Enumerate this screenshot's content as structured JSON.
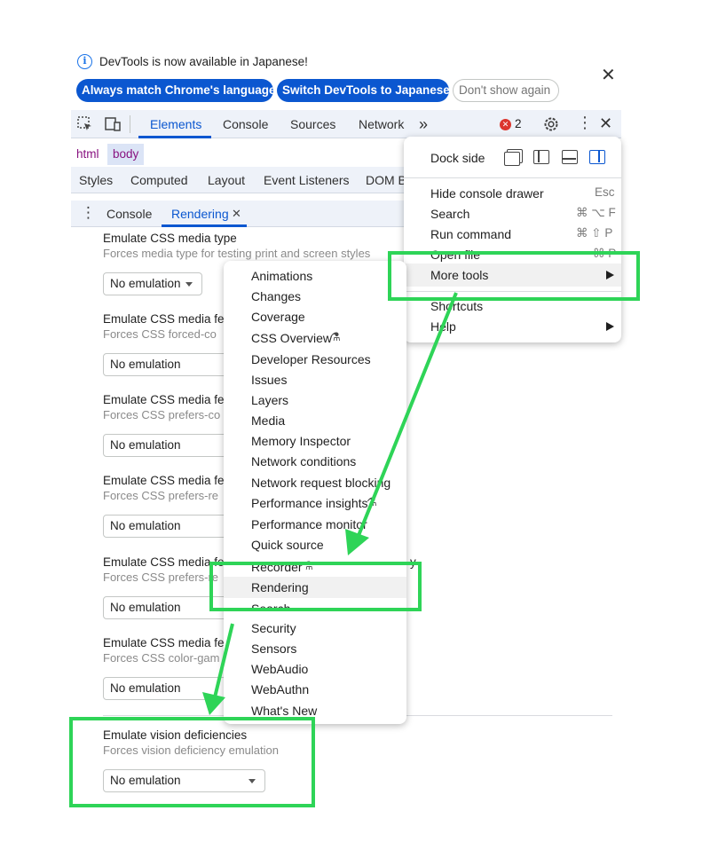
{
  "infobar": {
    "message": "DevTools is now available in Japanese!",
    "buttons": [
      "Always match Chrome's language",
      "Switch DevTools to Japanese",
      "Don't show again"
    ]
  },
  "toolbar": {
    "tabs": [
      "Elements",
      "Console",
      "Sources",
      "Network"
    ],
    "more_tabs": "»",
    "error_count": "2"
  },
  "breadcrumb": [
    "html",
    "body"
  ],
  "subtabs": [
    "Styles",
    "Computed",
    "Layout",
    "Event Listeners",
    "DOM B"
  ],
  "drawer": {
    "tabs": [
      "Console",
      "Rendering"
    ]
  },
  "rendering": {
    "sections": [
      {
        "title": "Emulate CSS media type",
        "desc": "Forces media type for testing print and screen styles",
        "value": "No emulation"
      },
      {
        "title": "Emulate CSS media fe",
        "desc": "Forces CSS forced-co",
        "value": "No emulation"
      },
      {
        "title": "Emulate CSS media fe",
        "desc": "Forces CSS prefers-co",
        "value": "No emulation"
      },
      {
        "title": "Emulate CSS media fe",
        "desc": "Forces CSS prefers-re",
        "value": "No emulation"
      },
      {
        "title": "Emulate CSS media fe",
        "title_tail": "y",
        "desc": "Forces CSS prefers-re",
        "value": "No emulation"
      },
      {
        "title": "Emulate CSS media fe",
        "desc": "Forces CSS color-gam",
        "value": "No emulation"
      },
      {
        "title": "Emulate vision deficiencies",
        "desc": "Forces vision deficiency emulation",
        "value": "No emulation"
      }
    ]
  },
  "main_menu": {
    "dock_side_label": "Dock side",
    "items": [
      {
        "label": "Hide console drawer",
        "shortcut": "Esc"
      },
      {
        "label": "Search",
        "shortcut": "⌘ ⌥ F"
      },
      {
        "label": "Run command",
        "shortcut": "⌘ ⇧ P"
      },
      {
        "label": "Open file",
        "shortcut": "⌘ P"
      },
      {
        "label": "More tools",
        "shortcut": ""
      },
      {
        "label": "Shortcuts",
        "shortcut": ""
      },
      {
        "label": "Help",
        "shortcut": ""
      }
    ]
  },
  "more_tools_menu": {
    "items": [
      "Animations",
      "Changes",
      "Coverage",
      "CSS Overview",
      "Developer Resources",
      "Issues",
      "Layers",
      "Media",
      "Memory Inspector",
      "Network conditions",
      "Network request blocking",
      "Performance insights",
      "Performance monitor",
      "Quick source",
      "Recorder",
      "Rendering",
      "Search",
      "Security",
      "Sensors",
      "WebAudio",
      "WebAuthn",
      "What's New"
    ],
    "experimental": [
      "CSS Overview",
      "Performance insights",
      "Recorder"
    ]
  },
  "colors": {
    "accent": "#0b57d0",
    "annotation_green": "#2ed457",
    "error_red": "#dc362e"
  }
}
